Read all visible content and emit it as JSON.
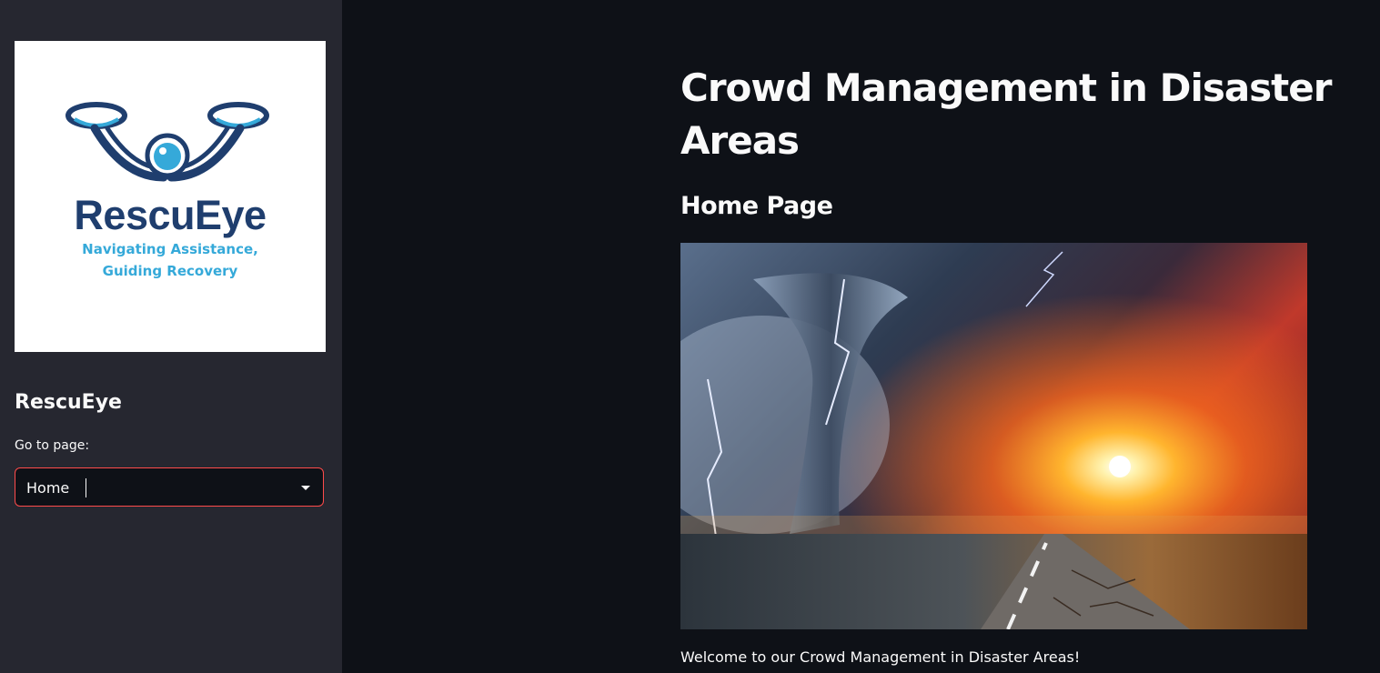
{
  "sidebar": {
    "logo": {
      "brand_name": "RescuEye",
      "tagline_line1": "Navigating Assistance,",
      "tagline_line2": "Guiding Recovery",
      "brand_color": "#1f3e6e",
      "tagline_color": "#35a9d9"
    },
    "title": "RescuEye",
    "page_select": {
      "label": "Go to page:",
      "value": "Home"
    }
  },
  "main": {
    "title": "Crowd Management in Disaster Areas",
    "subtitle": "Home Page",
    "hero_image": "tornado-storm-sunset-road-image",
    "welcome_text": "Welcome to our Crowd Management in Disaster Areas!"
  },
  "colors": {
    "app_background": "#0e1117",
    "sidebar_background": "#262730",
    "accent": "#ff4b4b",
    "text": "#fafafa"
  }
}
